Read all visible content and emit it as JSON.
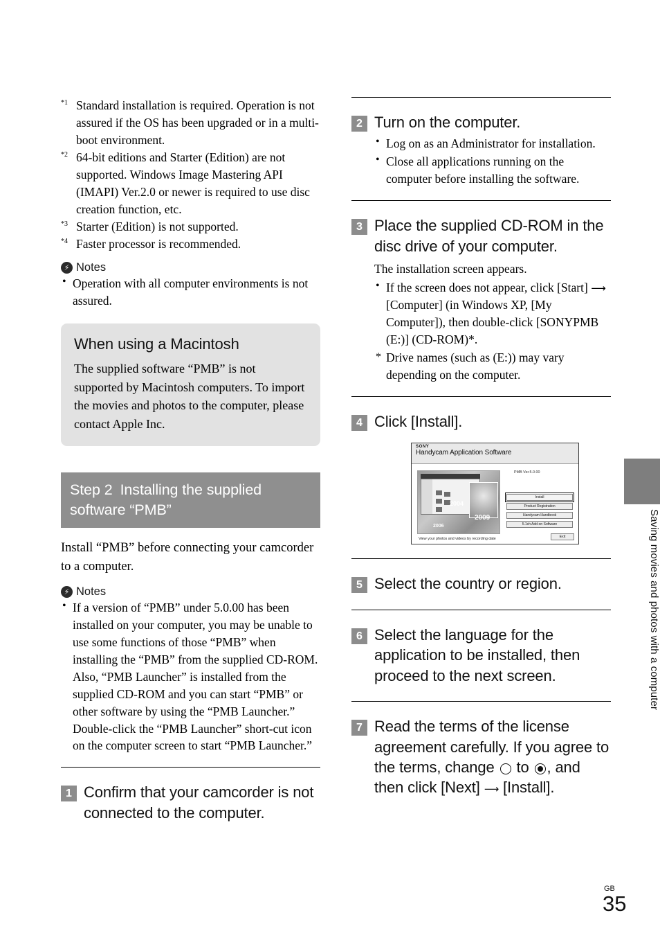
{
  "footnotes": [
    {
      "mark": "*1",
      "text": "Standard installation is required. Operation is not assured if the OS has been upgraded or in a multi-boot environment."
    },
    {
      "mark": "*2",
      "text": "64-bit editions and Starter (Edition) are not supported. Windows Image Mastering API (IMAPI) Ver.2.0 or newer is required to use disc creation function, etc."
    },
    {
      "mark": "*3",
      "text": "Starter (Edition) is not supported."
    },
    {
      "mark": "*4",
      "text": "Faster processor is recommended."
    }
  ],
  "notes_top": {
    "label": "Notes",
    "icon": "lightning-bolt-icon",
    "items": [
      "Operation with all computer environments is not assured."
    ]
  },
  "mac_box": {
    "title": "When using a Macintosh",
    "body": "The supplied software “PMB” is not supported by Macintosh computers. To import the movies and photos to the computer, please contact Apple Inc."
  },
  "step2_band": {
    "step_label": "Step 2",
    "title": "Installing the supplied software “PMB”"
  },
  "lead_text": "Install “PMB” before connecting your camcorder to a computer.",
  "notes_pmb": {
    "label": "Notes",
    "icon": "lightning-bolt-icon",
    "items": [
      "If a version of “PMB” under 5.0.00 has been installed on your computer, you may be unable to use some functions of those “PMB” when installing the “PMB” from the supplied CD-ROM. Also, “PMB Launcher” is installed from the supplied CD-ROM and you can start “PMB” or other software by using the “PMB Launcher.” Double-click the “PMB Launcher” short-cut icon on the computer screen to start “PMB Launcher.”"
    ]
  },
  "steps": {
    "s1": {
      "number": "1",
      "title": "Confirm that your camcorder is not connected to the computer."
    },
    "s2": {
      "number": "2",
      "title": "Turn on the computer.",
      "bullets": [
        "Log on as an Administrator for installation.",
        "Close all applications running on the computer before installing the software."
      ]
    },
    "s3": {
      "number": "3",
      "title": "Place the supplied CD-ROM in the disc drive of your computer.",
      "intro": "The installation screen appears.",
      "bullet_a": "If the screen does not appear, click [Start]",
      "bullet_a2": "[Computer] (in Windows XP, [My Computer]), then double-click [SONYPMB (E:)] (CD-ROM)*.",
      "footnote": "Drive names (such as (E:)) may vary depending on the computer."
    },
    "s4": {
      "number": "4",
      "title": "Click [Install]."
    },
    "s5": {
      "number": "5",
      "title": "Select the country or region."
    },
    "s6": {
      "number": "6",
      "title": "Select the language for the application to be installed, then proceed to the next screen."
    },
    "s7": {
      "number": "7",
      "title_a": "Read the terms of the license agreement carefully. If you agree to the terms, change",
      "title_b": "to",
      "title_c": ", and then click [Next]",
      "title_d": "[Install]."
    }
  },
  "installer_shot": {
    "brand": "SONY",
    "title": "Handycam Application Software",
    "version": "PMB Ver.5.0.00",
    "caption": "View your photos and videos by recording date",
    "years": {
      "a": "2004",
      "b": "2009",
      "c": "2006"
    },
    "buttons": [
      "Install",
      "Product Registration",
      "Handycam Handbook",
      "5.1ch Add-on Software"
    ],
    "exit_button": "Exit"
  },
  "side_tab": {
    "text": "Saving movies and photos with a computer"
  },
  "folio": {
    "region": "GB",
    "page": "35"
  },
  "arrow_glyph": "⟶"
}
